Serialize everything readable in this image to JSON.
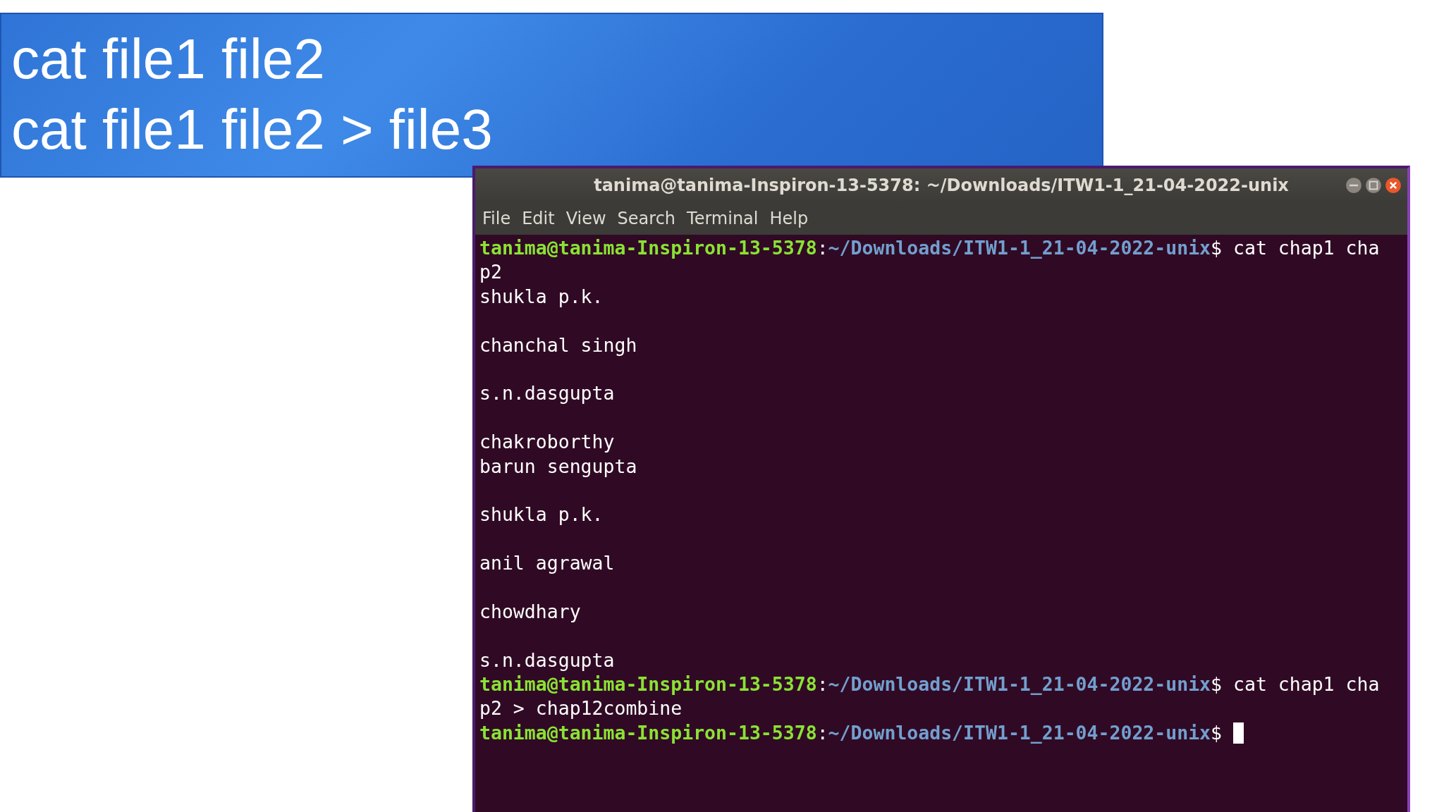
{
  "slide": {
    "lines": [
      "cat file1 file2",
      "cat file1 file2 > file3"
    ]
  },
  "window": {
    "title": "tanima@tanima-Inspiron-13-5378: ~/Downloads/ITW1-1_21-04-2022-unix"
  },
  "menu": [
    "File",
    "Edit",
    "View",
    "Search",
    "Terminal",
    "Help"
  ],
  "terminal": {
    "lines": [
      {
        "kind": "prompt",
        "user": "tanima@tanima-Inspiron-13-5378",
        "colon": ":",
        "path": "~/Downloads/ITW1-1_21-04-2022-unix",
        "dollar": "$",
        "command": "cat chap1 cha",
        "cursor": false
      },
      {
        "kind": "output",
        "text": "p2"
      },
      {
        "kind": "output",
        "text": "shukla p.k."
      },
      {
        "kind": "blank"
      },
      {
        "kind": "output",
        "text": "chanchal singh"
      },
      {
        "kind": "blank"
      },
      {
        "kind": "output",
        "text": "s.n.dasgupta"
      },
      {
        "kind": "blank"
      },
      {
        "kind": "output",
        "text": "chakroborthy"
      },
      {
        "kind": "output",
        "text": "barun sengupta"
      },
      {
        "kind": "blank"
      },
      {
        "kind": "output",
        "text": "shukla p.k."
      },
      {
        "kind": "blank"
      },
      {
        "kind": "output",
        "text": "anil agrawal"
      },
      {
        "kind": "blank"
      },
      {
        "kind": "output",
        "text": "chowdhary"
      },
      {
        "kind": "blank"
      },
      {
        "kind": "output",
        "text": "s.n.dasgupta"
      },
      {
        "kind": "prompt",
        "user": "tanima@tanima-Inspiron-13-5378",
        "colon": ":",
        "path": "~/Downloads/ITW1-1_21-04-2022-unix",
        "dollar": "$",
        "command": "cat chap1 cha",
        "cursor": false
      },
      {
        "kind": "output",
        "text": "p2 > chap12combine"
      },
      {
        "kind": "prompt",
        "user": "tanima@tanima-Inspiron-13-5378",
        "colon": ":",
        "path": "~/Downloads/ITW1-1_21-04-2022-unix",
        "dollar": "$",
        "cursor": true
      }
    ]
  }
}
